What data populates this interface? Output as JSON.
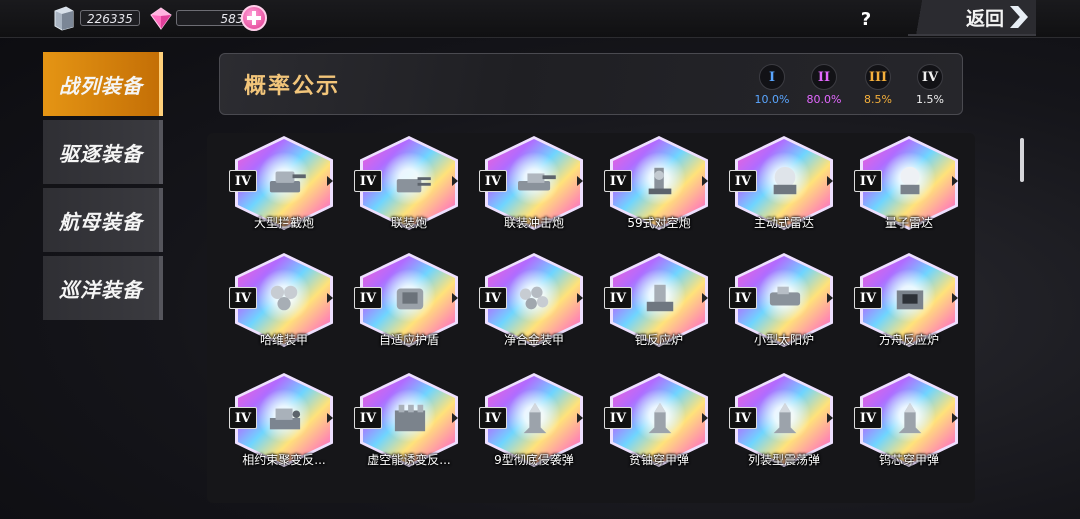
{
  "resources": {
    "metal": {
      "icon": "metal-ingot-icon",
      "value": "226335"
    },
    "gem": {
      "icon": "pink-gem-icon",
      "value": "5836"
    },
    "add_icon": "plus-icon"
  },
  "top_right": {
    "help_label": "?",
    "back_label": "返回",
    "back_icon": "chevron-right-icon"
  },
  "sidebar": {
    "items": [
      {
        "label": "战列装备",
        "active": true
      },
      {
        "label": "驱逐装备",
        "active": false
      },
      {
        "label": "航母装备",
        "active": false
      },
      {
        "label": "巡洋装备",
        "active": false
      }
    ]
  },
  "header": {
    "title": "概率公示",
    "rarities": [
      {
        "tier": "I",
        "pct": "10.0%",
        "color": "#5aa6ff"
      },
      {
        "tier": "II",
        "pct": "80.0%",
        "color": "#e368ff"
      },
      {
        "tier": "III",
        "pct": "8.5%",
        "color": "#f5b03c"
      },
      {
        "tier": "IV",
        "pct": "1.5%",
        "color": "#f0f0f0"
      }
    ]
  },
  "grid": {
    "tier_label": "IV",
    "items": [
      {
        "name": "大型拦截炮",
        "icon": "turret-icon"
      },
      {
        "name": "联装炮",
        "icon": "twin-cannon-icon"
      },
      {
        "name": "联装冲击炮",
        "icon": "impact-cannon-icon"
      },
      {
        "name": "59式对空炮",
        "icon": "aa-gun-icon"
      },
      {
        "name": "主动式雷达",
        "icon": "radar-dome-icon"
      },
      {
        "name": "量子雷达",
        "icon": "quantum-radar-icon"
      },
      {
        "name": "哈维装甲",
        "icon": "hex-armor-icon"
      },
      {
        "name": "自适应护盾",
        "icon": "shield-generator-icon"
      },
      {
        "name": "净合金装甲",
        "icon": "alloy-armor-icon"
      },
      {
        "name": "钯反应炉",
        "icon": "reactor-icon"
      },
      {
        "name": "小型太阳炉",
        "icon": "solar-furnace-icon"
      },
      {
        "name": "方舟反应炉",
        "icon": "ark-reactor-icon"
      },
      {
        "name": "相约束聚变反...",
        "icon": "fusion-reactor-icon"
      },
      {
        "name": "虚空能诱变反...",
        "icon": "void-reactor-icon"
      },
      {
        "name": "9型彻底侵袭弹",
        "icon": "missile-icon"
      },
      {
        "name": "贫铀穿甲弹",
        "icon": "missile-icon"
      },
      {
        "name": "列装型震荡弹",
        "icon": "missile-icon"
      },
      {
        "name": "钨芯穿甲弹",
        "icon": "missile-icon"
      }
    ]
  }
}
